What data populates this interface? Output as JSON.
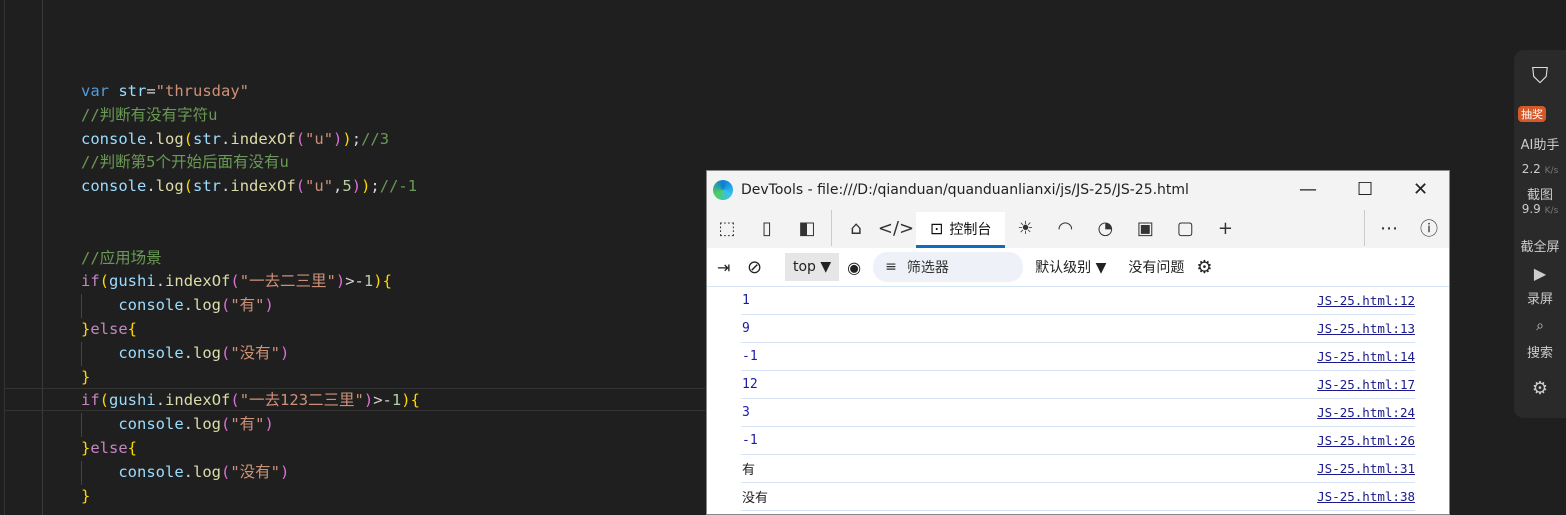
{
  "editor": {
    "lines": [
      [
        [
          "kw",
          "var "
        ],
        [
          "v",
          "str"
        ],
        [
          "",
          "="
        ],
        [
          "s",
          "\"thrusday\""
        ]
      ],
      [
        [
          "c",
          "//判断有没有字符u"
        ]
      ],
      [
        [
          "v",
          "console"
        ],
        [
          "",
          "."
        ],
        [
          "f",
          "log"
        ],
        [
          "b1",
          "("
        ],
        [
          "v",
          "str"
        ],
        [
          "",
          "."
        ],
        [
          "f",
          "indexOf"
        ],
        [
          "b2",
          "("
        ],
        [
          "s",
          "\"u\""
        ],
        [
          "b2",
          ")"
        ],
        [
          "b1",
          ")"
        ],
        [
          "",
          ";"
        ],
        [
          "c",
          "//3"
        ]
      ],
      [
        [
          "c",
          "//判断第5个开始后面有没有u"
        ]
      ],
      [
        [
          "v",
          "console"
        ],
        [
          "",
          "."
        ],
        [
          "f",
          "log"
        ],
        [
          "b1",
          "("
        ],
        [
          "v",
          "str"
        ],
        [
          "",
          "."
        ],
        [
          "f",
          "indexOf"
        ],
        [
          "b2",
          "("
        ],
        [
          "s",
          "\"u\""
        ],
        [
          "",
          ","
        ],
        [
          "n",
          "5"
        ],
        [
          "b2",
          ")"
        ],
        [
          "b1",
          ")"
        ],
        [
          "",
          ";"
        ],
        [
          "c",
          "//-1"
        ]
      ],
      [],
      [],
      [
        [
          "c",
          "//应用场景"
        ]
      ],
      [
        [
          "p",
          "if"
        ],
        [
          "b1",
          "("
        ],
        [
          "v",
          "gushi"
        ],
        [
          "",
          "."
        ],
        [
          "f",
          "indexOf"
        ],
        [
          "b2",
          "("
        ],
        [
          "s",
          "\"一去二三里\""
        ],
        [
          "b2",
          ")"
        ],
        [
          "",
          ">-"
        ],
        [
          "n",
          "1"
        ],
        [
          "b1",
          ")"
        ],
        [
          "b1",
          "{"
        ]
      ],
      [
        [
          "",
          "    "
        ],
        [
          "v",
          "console"
        ],
        [
          "",
          "."
        ],
        [
          "f",
          "log"
        ],
        [
          "b2",
          "("
        ],
        [
          "s",
          "\"有\""
        ],
        [
          "b2",
          ")"
        ]
      ],
      [
        [
          "b1",
          "}"
        ],
        [
          "p",
          "else"
        ],
        [
          "b1",
          "{"
        ]
      ],
      [
        [
          "",
          "    "
        ],
        [
          "v",
          "console"
        ],
        [
          "",
          "."
        ],
        [
          "f",
          "log"
        ],
        [
          "b2",
          "("
        ],
        [
          "s",
          "\"没有\""
        ],
        [
          "b2",
          ")"
        ]
      ],
      [
        [
          "b1",
          "}"
        ]
      ],
      [
        [
          "p",
          "if"
        ],
        [
          "b1",
          "("
        ],
        [
          "v",
          "gushi"
        ],
        [
          "",
          "."
        ],
        [
          "f",
          "indexOf"
        ],
        [
          "b2",
          "("
        ],
        [
          "s",
          "\"一去123二三里\""
        ],
        [
          "b2",
          ")"
        ],
        [
          "",
          ">-"
        ],
        [
          "n",
          "1"
        ],
        [
          "b1",
          ")"
        ],
        [
          "b1",
          "{"
        ]
      ],
      [
        [
          "",
          "    "
        ],
        [
          "v",
          "console"
        ],
        [
          "",
          "."
        ],
        [
          "f",
          "log"
        ],
        [
          "b2",
          "("
        ],
        [
          "s",
          "\"有\""
        ],
        [
          "b2",
          ")"
        ]
      ],
      [
        [
          "b1",
          "}"
        ],
        [
          "p",
          "else"
        ],
        [
          "b1",
          "{"
        ]
      ],
      [
        [
          "",
          "    "
        ],
        [
          "v",
          "console"
        ],
        [
          "",
          "."
        ],
        [
          "f",
          "log"
        ],
        [
          "b2",
          "("
        ],
        [
          "s",
          "\"没有\""
        ],
        [
          "b2",
          ")"
        ]
      ],
      [
        [
          "b1",
          "}"
        ]
      ]
    ]
  },
  "devtools": {
    "title": "DevTools - file:///D:/qianduan/quanduanlianxi/js/JS-25/JS-25.html",
    "console_tab": "控制台",
    "context": "top",
    "filter_placeholder": "筛选器",
    "level": "默认级别",
    "issues": "没有问题",
    "rows": [
      {
        "value": "1",
        "source": "JS-25.html:12"
      },
      {
        "value": "9",
        "source": "JS-25.html:13"
      },
      {
        "value": "-1",
        "source": "JS-25.html:14"
      },
      {
        "value": "12",
        "source": "JS-25.html:17"
      },
      {
        "value": "3",
        "source": "JS-25.html:24"
      },
      {
        "value": "-1",
        "source": "JS-25.html:26"
      },
      {
        "value": "有",
        "source": "JS-25.html:31",
        "text": true
      },
      {
        "value": "没有",
        "source": "JS-25.html:38",
        "text": true
      }
    ]
  },
  "sidebar": {
    "badge": "抽奖",
    "ai": "AI助手",
    "screenshot": "截图",
    "fullscreen": "截全屏",
    "record": "录屏",
    "search": "搜索",
    "speed_up": "2.2",
    "speed_up_unit": "K/s",
    "speed_down": "9.9",
    "speed_down_unit": "K/s"
  }
}
